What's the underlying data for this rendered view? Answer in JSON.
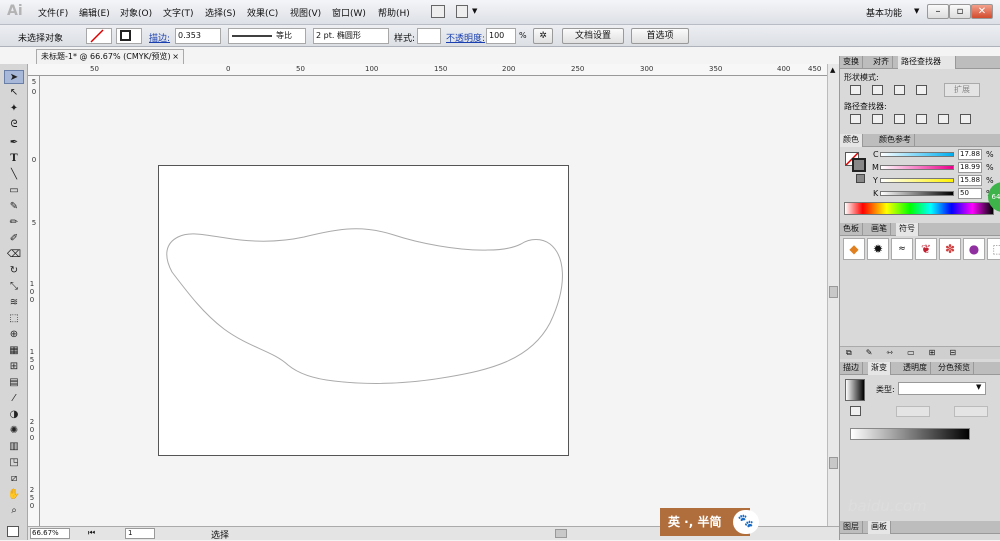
{
  "app": {
    "logo": "Ai"
  },
  "menu": [
    "文件(F)",
    "编辑(E)",
    "对象(O)",
    "文字(T)",
    "选择(S)",
    "效果(C)",
    "视图(V)",
    "窗口(W)",
    "帮助(H)"
  ],
  "workspace": "基本功能",
  "control_bar": {
    "selection": "未选择对象",
    "stroke_label": "描边:",
    "stroke_value": "0.353",
    "profile": "等比",
    "brush": "2 pt. 椭圆形",
    "style_label": "样式:",
    "opacity_label": "不透明度:",
    "opacity_value": "100",
    "opacity_unit": "%",
    "doc_setup": "文档设置",
    "preferences": "首选项"
  },
  "document_tab": "未标题-1* @ 66.67% (CMYK/预览)",
  "rulers": {
    "h_ticks": [
      "50",
      "0",
      "50",
      "100",
      "150",
      "200",
      "250",
      "300",
      "350",
      "400",
      "450"
    ],
    "v_ticks": [
      "5",
      "0",
      "0",
      "5",
      "1 0 0",
      "1 5 0",
      "2 0 0",
      "2 5 0"
    ]
  },
  "status": {
    "zoom": "66.67%",
    "page": "1",
    "tool": "选择"
  },
  "panels": {
    "top_tabs": [
      "变换",
      "对齐",
      "路径查找器"
    ],
    "shape_modes": "形状模式:",
    "expand": "扩展",
    "pathfinders": "路径查找器:",
    "color_tabs": [
      "颜色",
      "颜色参考"
    ],
    "cmyk": [
      {
        "channel": "C",
        "value": "17.88",
        "unit": "%"
      },
      {
        "channel": "M",
        "value": "18.99",
        "unit": "%"
      },
      {
        "channel": "Y",
        "value": "15.88",
        "unit": "%"
      },
      {
        "channel": "K",
        "value": "50",
        "unit": "%"
      }
    ],
    "swatch_tabs": [
      "色板",
      "画笔",
      "符号"
    ],
    "stroke_tabs": [
      "描边",
      "渐变",
      "透明度",
      "分色预览"
    ],
    "gradient_type_label": "类型:",
    "bottom_tabs": [
      "图层",
      "画板"
    ]
  },
  "watermark": {
    "ime": "英 ·, 半简",
    "site": "baidu.com"
  },
  "badge": "64",
  "colors": {
    "accent_link": "#1a3fb0",
    "ime_bg": "#b06e3d",
    "badge": "#3db34a"
  }
}
